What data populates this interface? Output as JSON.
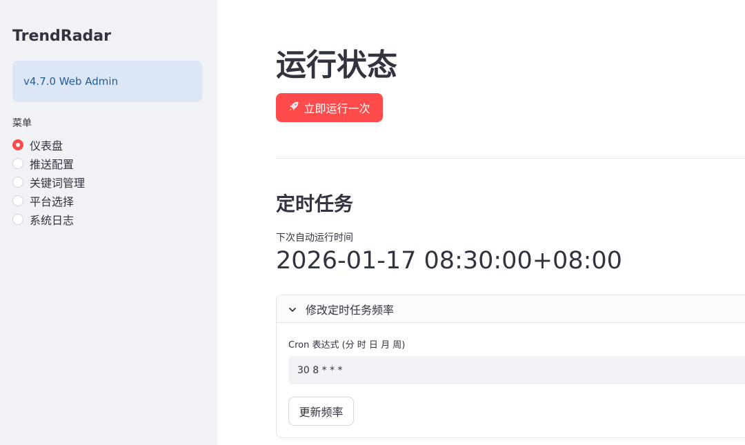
{
  "sidebar": {
    "app_title": "TrendRadar",
    "version": "v4.7.0 Web Admin",
    "menu_label": "菜单",
    "menu_items": [
      {
        "label": "仪表盘",
        "selected": true
      },
      {
        "label": "推送配置",
        "selected": false
      },
      {
        "label": "关键词管理",
        "selected": false
      },
      {
        "label": "平台选择",
        "selected": false
      },
      {
        "label": "系统日志",
        "selected": false
      }
    ]
  },
  "main": {
    "page_title": "运行状态",
    "run_button": {
      "icon": "rocket-icon",
      "label": "立即运行一次"
    },
    "schedule": {
      "section_title": "定时任务",
      "next_run_label": "下次自动运行时间",
      "next_run_value": "2026-01-17 08:30:00+08:00",
      "expander": {
        "title": "修改定时任务频率",
        "expanded": true,
        "cron_label": "Cron 表达式 (分 时 日 月 周)",
        "cron_value": "30 8 * * *",
        "update_button": "更新频率"
      }
    }
  },
  "colors": {
    "accent": "#ff4b4b",
    "sidebar_bg": "#f0f2f6",
    "info_bg": "#dce6f5",
    "info_text": "#1f5e9b"
  }
}
